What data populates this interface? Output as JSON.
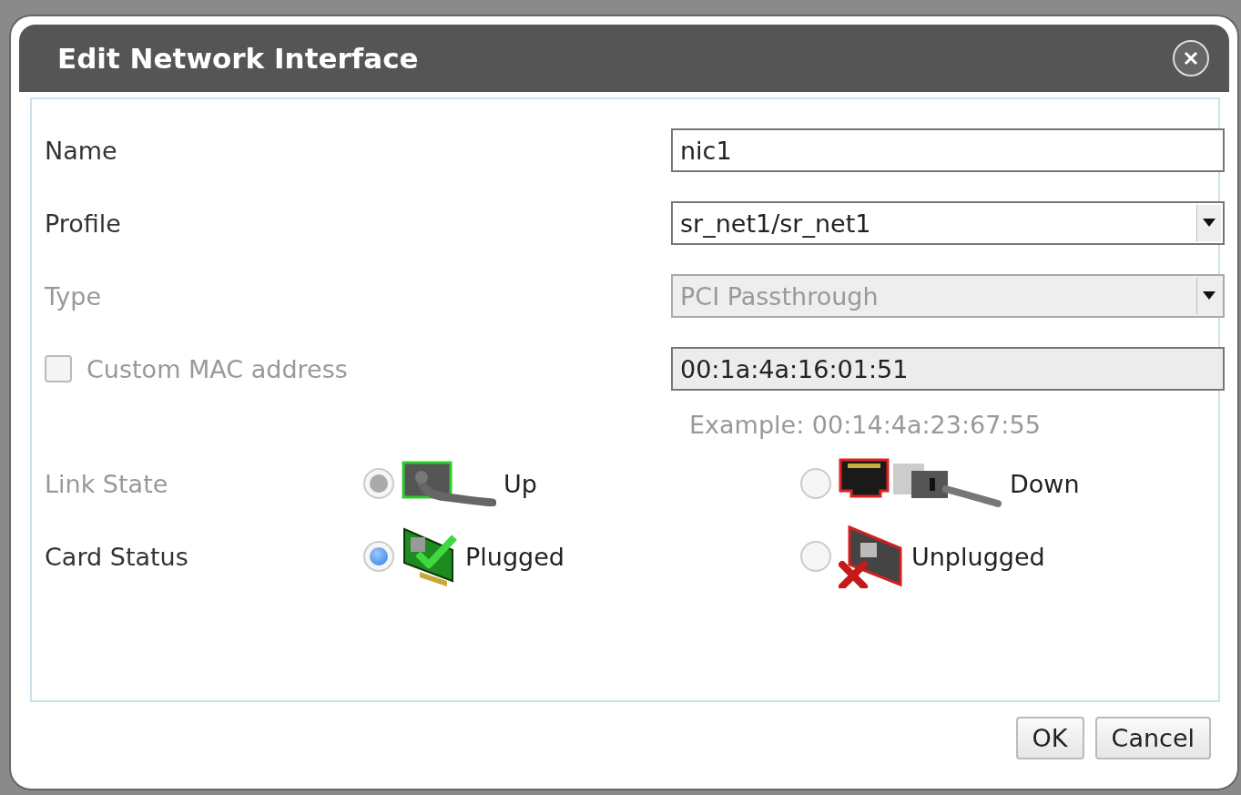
{
  "dialog": {
    "title": "Edit Network Interface"
  },
  "fields": [
    {
      "kind": "text",
      "label": "Name",
      "value": "nic1",
      "disabled": false
    },
    {
      "kind": "select",
      "label": "Profile",
      "value": "sr_net1/sr_net1",
      "disabled": false
    },
    {
      "kind": "select",
      "label": "Type",
      "value": "PCI Passthrough",
      "disabled": true
    },
    {
      "kind": "checkbox",
      "label": "Custom MAC address",
      "checked": false,
      "disabled": true,
      "value": "00:1a:4a:16:01:51",
      "hint": "Example: 00:14:4a:23:67:55"
    }
  ],
  "radio_groups": [
    {
      "label": "Link State",
      "disabled": true,
      "options": [
        {
          "label": "Up",
          "kind": "link-up",
          "selected": true
        },
        {
          "label": "Down",
          "kind": "link-down",
          "selected": false
        }
      ]
    },
    {
      "label": "Card Status",
      "disabled": false,
      "options": [
        {
          "label": "Plugged",
          "kind": "plugged",
          "selected": true
        },
        {
          "label": "Unplugged",
          "kind": "unplugged",
          "selected": false
        }
      ]
    }
  ],
  "buttons": [
    "OK",
    "Cancel"
  ]
}
